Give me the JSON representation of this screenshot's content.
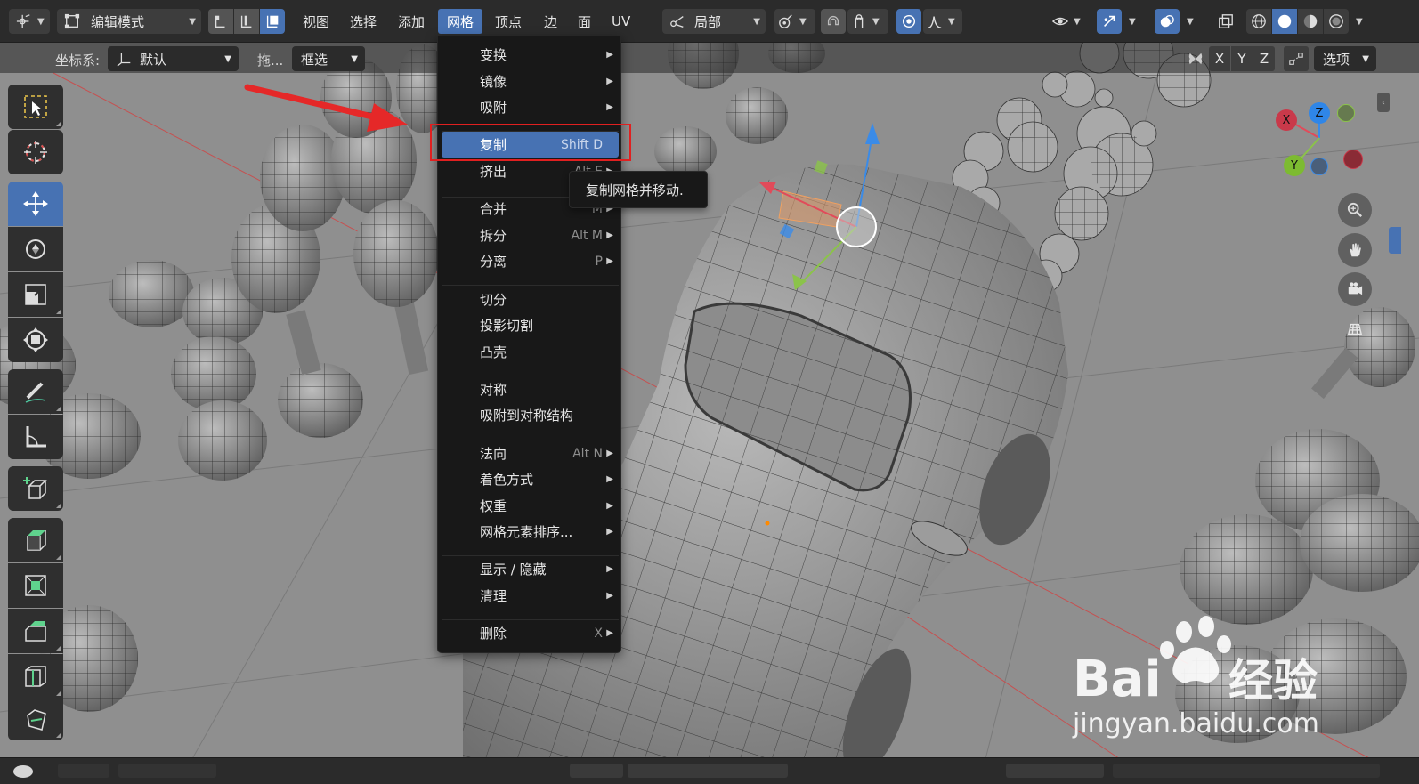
{
  "header": {
    "mode_selector": {
      "label": "编辑模式",
      "icon": "edit-mode-icon"
    },
    "menus": [
      {
        "label": "视图",
        "active": false
      },
      {
        "label": "选择",
        "active": false
      },
      {
        "label": "添加",
        "active": false
      },
      {
        "label": "网格",
        "active": true
      },
      {
        "label": "顶点",
        "active": false
      },
      {
        "label": "边",
        "active": false
      },
      {
        "label": "面",
        "active": false
      },
      {
        "label": "UV",
        "active": false
      }
    ],
    "pivot_selector": {
      "label": "局部"
    }
  },
  "tool_settings": {
    "coord_label": "坐标系:",
    "coord_value": "默认",
    "drag_label": "拖...",
    "drag_value": "框选",
    "axes": [
      "X",
      "Y",
      "Z"
    ],
    "options_label": "选项"
  },
  "dropdown": {
    "items": [
      {
        "label": "变换",
        "shortcut": "",
        "submenu": true
      },
      {
        "label": "镜像",
        "shortcut": "",
        "submenu": true
      },
      {
        "label": "吸附",
        "shortcut": "",
        "submenu": true
      },
      {
        "label": "复制",
        "shortcut": "Shift D",
        "submenu": false,
        "highlighted": true
      },
      {
        "label": "挤出",
        "shortcut": "Alt E",
        "submenu": true
      },
      {
        "label": "合并",
        "shortcut": "M",
        "submenu": true
      },
      {
        "label": "拆分",
        "shortcut": "Alt M",
        "submenu": true
      },
      {
        "label": "分离",
        "shortcut": "P",
        "submenu": true
      },
      {
        "label": "切分",
        "shortcut": "",
        "submenu": false
      },
      {
        "label": "投影切割",
        "shortcut": "",
        "submenu": false
      },
      {
        "label": "凸壳",
        "shortcut": "",
        "submenu": false
      },
      {
        "label": "对称",
        "shortcut": "",
        "submenu": false
      },
      {
        "label": "吸附到对称结构",
        "shortcut": "",
        "submenu": false
      },
      {
        "label": "法向",
        "shortcut": "Alt N",
        "submenu": true
      },
      {
        "label": "着色方式",
        "shortcut": "",
        "submenu": true
      },
      {
        "label": "权重",
        "shortcut": "",
        "submenu": true
      },
      {
        "label": "网格元素排序...",
        "shortcut": "",
        "submenu": true
      },
      {
        "label": "显示 / 隐藏",
        "shortcut": "",
        "submenu": true
      },
      {
        "label": "清理",
        "shortcut": "",
        "submenu": true
      },
      {
        "label": "删除",
        "shortcut": "X",
        "submenu": true
      }
    ]
  },
  "tooltip": {
    "text": "复制网格并移动."
  },
  "gizmo": {
    "x": "X",
    "y": "Y",
    "z": "Z"
  },
  "watermark": {
    "text": "jingyan.baidu.com",
    "brand": "Bai",
    "brand2": "经验"
  },
  "colors": {
    "accent": "#4772b3",
    "menu_bg": "#181818",
    "header_bg": "#2b2b2b",
    "highlight_box": "#e02020",
    "axis_x": "#e14b5a",
    "axis_y": "#8bc34a",
    "axis_z": "#3a8be8"
  }
}
